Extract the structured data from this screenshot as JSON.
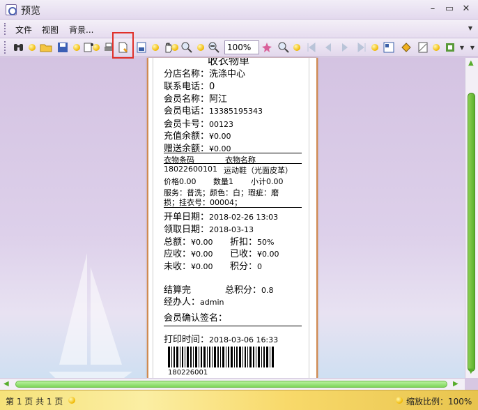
{
  "window": {
    "title": "预览"
  },
  "menu": {
    "file": "文件",
    "view": "视图",
    "background": "背景..."
  },
  "toolbar": {
    "zoom_value": "100%"
  },
  "receipt": {
    "heading": "收衣物单",
    "branch": "分店名称：洗涤中心",
    "phone": "联系电话：0",
    "member_name": "会员名称：阿江",
    "member_phone_label": "会员电话：",
    "member_phone": "13385195343",
    "card_label": "会员卡号：",
    "card_no": "00123",
    "recharge_label": "充值余额：",
    "recharge": "¥0.00",
    "gift_label": "赠送余额：",
    "gift": "¥0.00",
    "col_barcode": "衣物条码",
    "col_name": "衣物名称",
    "item_code": "18022600101",
    "item_name": "运动鞋（光面皮革）",
    "item_price": "价格0.00",
    "item_qty": "数量1",
    "item_subtotal": "小计0.00",
    "item_service_1": "服务：普洗；颜色：白；瑕疵：磨",
    "item_service_2": "损；挂衣号：00004；",
    "open_date_label": "开单日期：",
    "open_date": "2018-02-26 13:03",
    "pickup_date_label": "领取日期：",
    "pickup_date": "2018-03-13",
    "total_label": "总额：",
    "total": "¥0.00",
    "discount_label": "折扣：",
    "discount": "50%",
    "receivable_label": "应收：",
    "receivable": "¥0.00",
    "received_label": "已收：",
    "received": "¥0.00",
    "unpaid_label": "未收：",
    "unpaid": "¥0.00",
    "points_label": "积分：",
    "points": "0",
    "settled": "结算完",
    "total_points_label": "总积分：",
    "total_points": "0.8",
    "operator_label": "经办人：",
    "operator": "admin",
    "sign_label": "会员确认签名：",
    "print_time_label": "打印时间：",
    "print_time": "2018-03-06 16:33",
    "barcode_text": "180226001"
  },
  "status": {
    "pages": "第 1 页 共 1 页",
    "zoom": "缩放比例：100%"
  }
}
